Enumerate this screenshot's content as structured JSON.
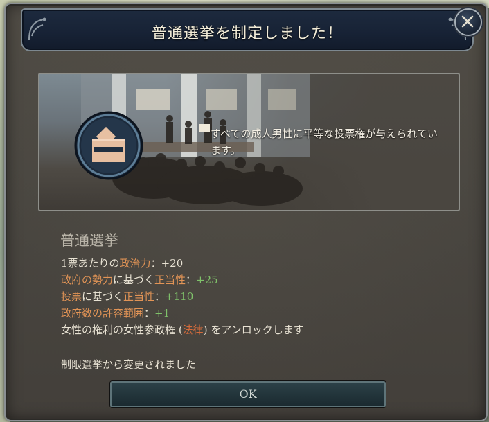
{
  "dialog": {
    "title": "普通選挙を制定しました！",
    "event_text": "すべての成人男性に平等な投票権が与えられています。",
    "effect_title": "普通選挙",
    "effects": [
      [
        {
          "text": "1票あたりの",
          "color": "w"
        },
        {
          "text": "政治力",
          "color": "o"
        },
        {
          "text": "：",
          "color": "w"
        },
        {
          "text": "+20",
          "color": "w"
        }
      ],
      [
        {
          "text": "政府の勢力",
          "color": "o"
        },
        {
          "text": "に基づく",
          "color": "w"
        },
        {
          "text": "正当性",
          "color": "o"
        },
        {
          "text": "：",
          "color": "w"
        },
        {
          "text": "+25",
          "color": "g"
        }
      ],
      [
        {
          "text": "投票",
          "color": "o"
        },
        {
          "text": "に基づく",
          "color": "w"
        },
        {
          "text": "正当性",
          "color": "o"
        },
        {
          "text": "：",
          "color": "w"
        },
        {
          "text": "+110",
          "color": "g"
        }
      ],
      [
        {
          "text": "政府数の許容範囲",
          "color": "o"
        },
        {
          "text": "：",
          "color": "w"
        },
        {
          "text": "+1",
          "color": "g"
        }
      ],
      [
        {
          "text": "女性の権利",
          "color": "w"
        },
        {
          "text": "の",
          "color": "w"
        },
        {
          "text": "女性参政権",
          "color": "w"
        },
        {
          "text": " (",
          "color": "w"
        },
        {
          "text": "法律",
          "color": "b"
        },
        {
          "text": ") ",
          "color": "w"
        },
        {
          "text": "をアンロックします",
          "color": "w"
        }
      ]
    ],
    "change_note": "制限選挙から変更されました",
    "ok_label": "OK"
  },
  "icons": {
    "close": "close-icon",
    "emblem": "ballot-box-icon"
  },
  "colors": {
    "header_bg": "#172235",
    "panel_bg": "#4a4741",
    "highlight": "#e29456",
    "positive": "#7fc16a",
    "law": "#d46b3b"
  }
}
